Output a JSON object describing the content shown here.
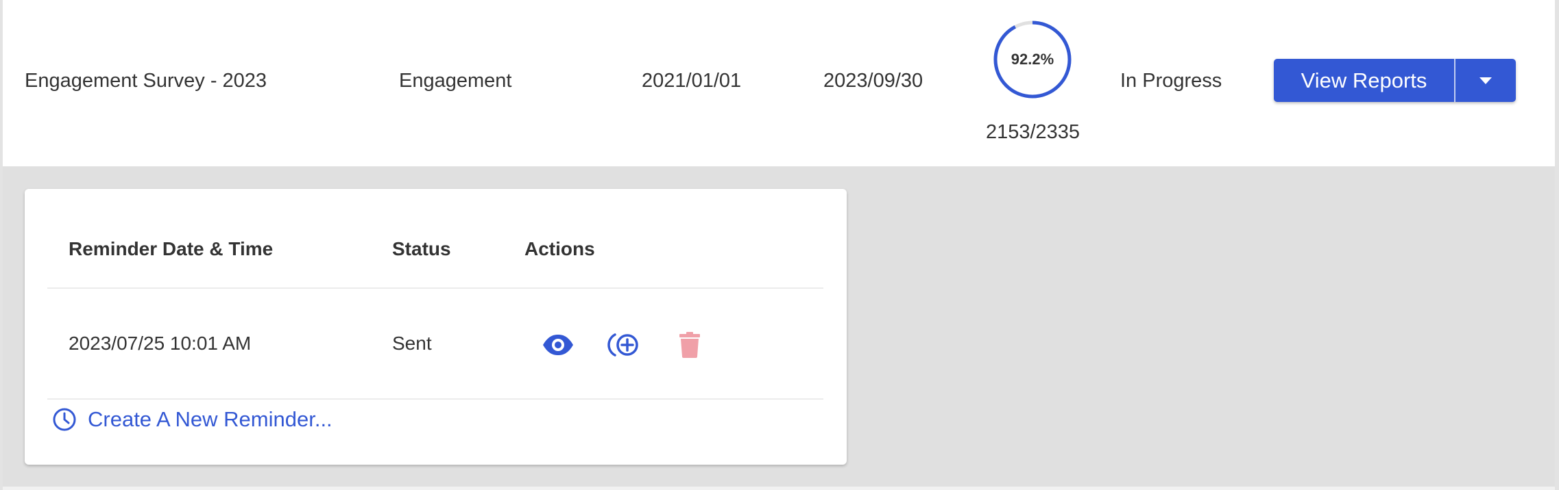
{
  "survey_row": {
    "name": "Engagement Survey - 2023",
    "type": "Engagement",
    "start_date": "2021/01/01",
    "end_date": "2023/09/30",
    "progress": {
      "percent_label": "92.2%",
      "percent_value": 0.922,
      "count_label": "2153/2335"
    },
    "status": "In Progress",
    "view_reports_label": "View Reports"
  },
  "reminders": {
    "headers": {
      "date_time": "Reminder Date & Time",
      "status": "Status",
      "actions": "Actions"
    },
    "rows": [
      {
        "date_time": "2023/07/25 10:01 AM",
        "status": "Sent"
      }
    ],
    "create_link": "Create A New Reminder..."
  },
  "icons": {
    "view": "eye-icon",
    "resend": "add-circle-icon",
    "delete": "trash-icon",
    "create": "clock-icon",
    "dropdown": "caret-down-icon"
  },
  "colors": {
    "accent": "#3358d4",
    "delete": "#f0a0a8",
    "panel_bg": "#e0e0e0",
    "ring_track": "#e0e0e0"
  }
}
